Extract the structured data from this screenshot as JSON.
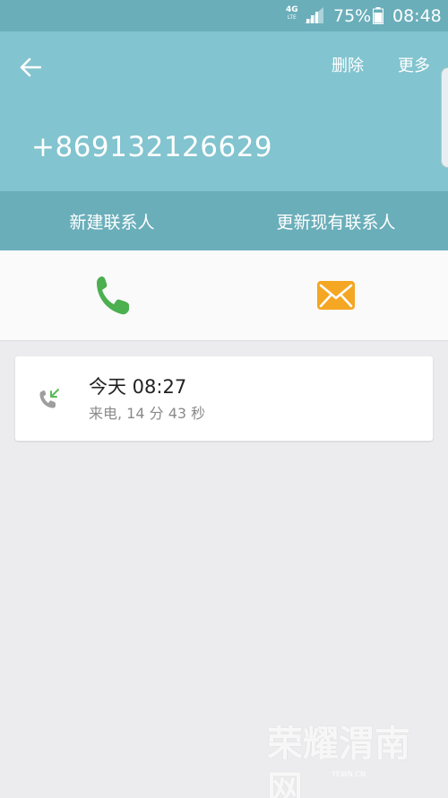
{
  "status_bar": {
    "network": "4G",
    "network_sub": "LTE",
    "battery": "75%",
    "time": "08:48"
  },
  "app_bar": {
    "delete_label": "删除",
    "more_label": "更多",
    "phone_number": "+869132126629"
  },
  "contact_options": {
    "new_contact": "新建联系人",
    "update_contact": "更新现有联系人"
  },
  "actions": {
    "call_icon": "phone-icon",
    "message_icon": "envelope-icon"
  },
  "call_log": [
    {
      "title": "今天 08:27",
      "detail": "来电, 14 分 43 秒",
      "icon": "incoming-call-icon"
    }
  ],
  "watermark": {
    "text": "荣耀渭南网",
    "url": "YEWN.CN"
  },
  "colors": {
    "header_teal": "#82c4cf",
    "header_dark_teal": "#6aaeba",
    "call_green": "#4caf50",
    "message_orange": "#f5a623",
    "incoming_arrow_green": "#5cb85c"
  }
}
